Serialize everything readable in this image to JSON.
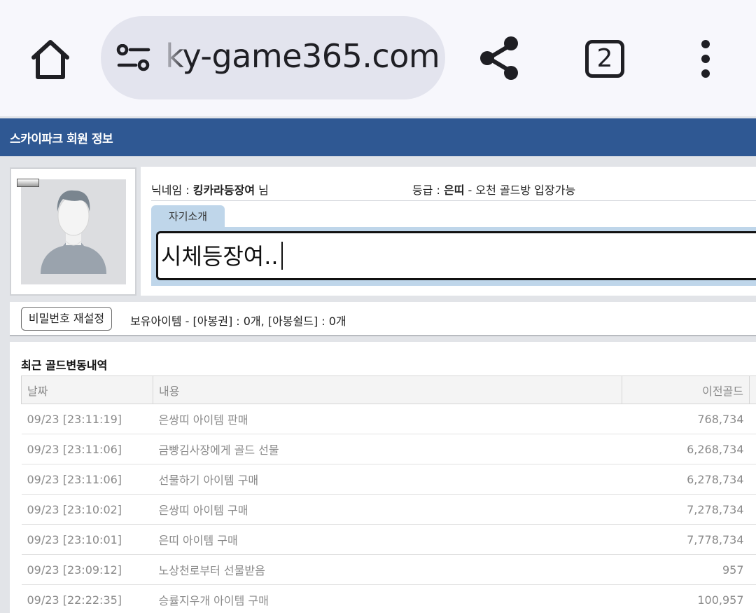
{
  "browser": {
    "url": "ky-game365.com",
    "tab_count": "2",
    "icons": [
      "home-icon",
      "site-settings-icon",
      "share-icon",
      "tab-switcher-icon",
      "more-vert-icon"
    ]
  },
  "header": {
    "title": "스카이파크 회원 정보"
  },
  "profile": {
    "nick_label": "닉네임 : ",
    "nickname": "킹카라등장여",
    "nick_suffix": " 님",
    "grade_label": "등급 : ",
    "grade": "은띠",
    "grade_desc": " - 오천 골드방 입장가능",
    "intro_tab": "자기소개",
    "intro_value": "시체등장여.."
  },
  "actions": {
    "password_reset": "비밀번호 재설정",
    "items_text": "보유아이템 - [아봉권] : 0개, [아봉쉴드] : 0개"
  },
  "history": {
    "title": "최근 골드변동내역",
    "columns": [
      "날짜",
      "내용",
      "이전골드"
    ],
    "rows": [
      [
        "09/23 [23:11:19]",
        "은쌍띠 아이템 판매",
        "768,734"
      ],
      [
        "09/23 [23:11:06]",
        "금빵김사장에게 골드 선물",
        "6,268,734"
      ],
      [
        "09/23 [23:11:06]",
        "선물하기 아이템 구매",
        "6,278,734"
      ],
      [
        "09/23 [23:10:02]",
        "은쌍띠 아이템 구매",
        "7,278,734"
      ],
      [
        "09/23 [23:10:01]",
        "은띠 아이템 구매",
        "7,778,734"
      ],
      [
        "09/23 [23:09:12]",
        "노상천로부터 선물받음",
        "957"
      ],
      [
        "09/23 [22:22:35]",
        "승률지우개 아이템 구매",
        "100,957"
      ]
    ]
  },
  "colors": {
    "header_bg": "#2f5893",
    "tab_bg": "#bfd6ea",
    "chrome_bg": "#f7f7fc",
    "url_pill_bg": "#e3e4ee"
  }
}
